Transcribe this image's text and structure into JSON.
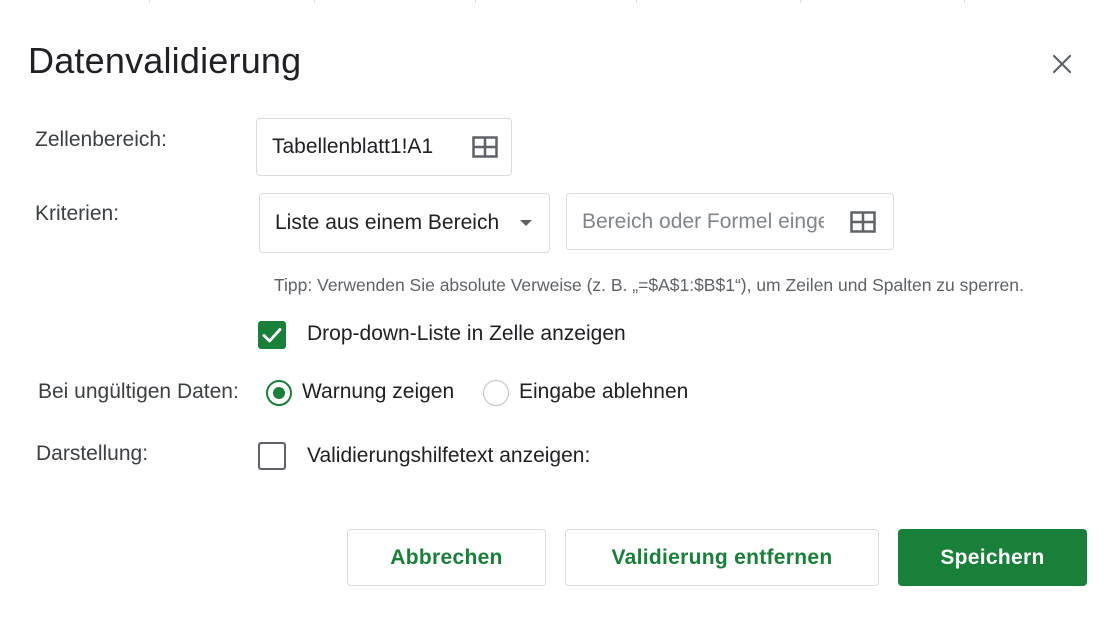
{
  "dialog": {
    "title": "Datenvalidierung"
  },
  "cell_range": {
    "label": "Zellenbereich:",
    "value": "Tabellenblatt1!A1"
  },
  "criteria": {
    "label": "Kriterien:",
    "selected": "Liste aus einem Bereich",
    "input_placeholder": "Bereich oder Formel eingeben",
    "tip": "Tipp: Verwenden Sie absolute Verweise (z. B. „=$A$1:$B$1“), um Zeilen und Spalten zu sperren.",
    "show_dropdown": {
      "label": "Drop-down-Liste in Zelle anzeigen",
      "checked": true
    }
  },
  "invalid_data": {
    "label": "Bei ungültigen Daten:",
    "options": [
      {
        "label": "Warnung zeigen",
        "selected": true
      },
      {
        "label": "Eingabe ablehnen",
        "selected": false
      }
    ]
  },
  "appearance": {
    "label": "Darstellung:",
    "help_text": {
      "label": "Validierungshilfetext anzeigen:",
      "checked": false
    }
  },
  "buttons": {
    "cancel": "Abbrechen",
    "remove": "Validierung entfernen",
    "save": "Speichern"
  },
  "colors": {
    "accent": "#188038",
    "border": "#dadce0",
    "text": "#202124",
    "secondary_text": "#5f6368"
  }
}
